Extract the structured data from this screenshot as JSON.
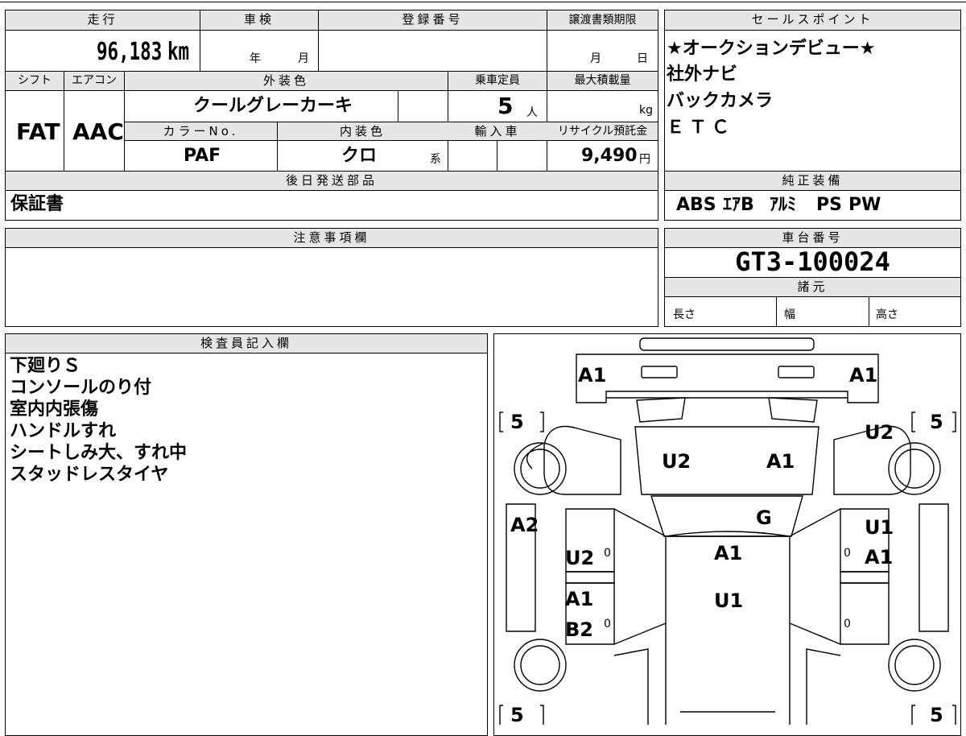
{
  "vehicle": {
    "mileage_label": "走行",
    "mileage_value": "96,183",
    "mileage_unit": "km",
    "shaken_label": "車検",
    "shaken_year_unit": "年",
    "shaken_month_unit": "月",
    "registration_label": "登録番号",
    "transfer_deadline_label": "譲渡書類期限",
    "transfer_month_unit": "月",
    "transfer_day_unit": "日",
    "shift_label": "シフト",
    "shift_value": "FAT",
    "aircon_label": "エアコン",
    "aircon_value": "AAC",
    "exterior_color_label": "外装色",
    "exterior_color_value": "クールグレーカーキ",
    "capacity_label": "乗車定員",
    "capacity_value": "5",
    "capacity_unit": "人",
    "max_load_label": "最大積載量",
    "max_load_unit": "kg",
    "color_no_label": "カラーNo.",
    "color_no_value": "PAF",
    "interior_color_label": "内装色",
    "interior_color_value": "クロ",
    "interior_color_suffix": "系",
    "import_label": "輸入車",
    "recycle_label": "リサイクル預託金",
    "recycle_value": "9,490",
    "recycle_unit": "円",
    "later_parts_label": "後日発送部品",
    "later_parts_value": "保証書"
  },
  "sales_points": {
    "label": "セールスポイント",
    "lines": [
      "★オークションデビュー★",
      "社外ナビ",
      "バックカメラ",
      "ＥＴＣ"
    ]
  },
  "equipment": {
    "label": "純正装備",
    "items": [
      "ABS",
      "ｴｱB",
      "ｱﾙﾐ",
      "PS",
      "PW"
    ]
  },
  "caution": {
    "label": "注意事項欄"
  },
  "chassis": {
    "label": "車台番号",
    "value": "GT3-100024",
    "specs_label": "諸元",
    "length_label": "長さ",
    "width_label": "幅",
    "height_label": "高さ"
  },
  "inspector": {
    "label": "検査員記入欄",
    "notes": [
      "下廻りＳ",
      "コンソールのり付",
      "室内内張傷",
      "ハンドルすれ",
      "シートしみ大、すれ中",
      "スタッドレスタイヤ"
    ]
  },
  "diagram": {
    "grades": {
      "front_left": "A1",
      "front_right": "A1",
      "hood_left": "U2",
      "hood_right": "A1",
      "windshield": "G",
      "left_fender": "A2",
      "left_front_door": "U2",
      "left_rear_door_1": "A1",
      "left_rear_door_2": "B2",
      "right_fender": "U2",
      "right_front_door_1": "U1",
      "right_front_door_2": "A1",
      "roof_1": "A1",
      "roof_2": "U1"
    },
    "tires": {
      "front_left": "5",
      "front_right": "5",
      "rear_left": "5",
      "rear_right": "5"
    },
    "door_marks": [
      "0",
      "0",
      "0",
      "0"
    ]
  }
}
